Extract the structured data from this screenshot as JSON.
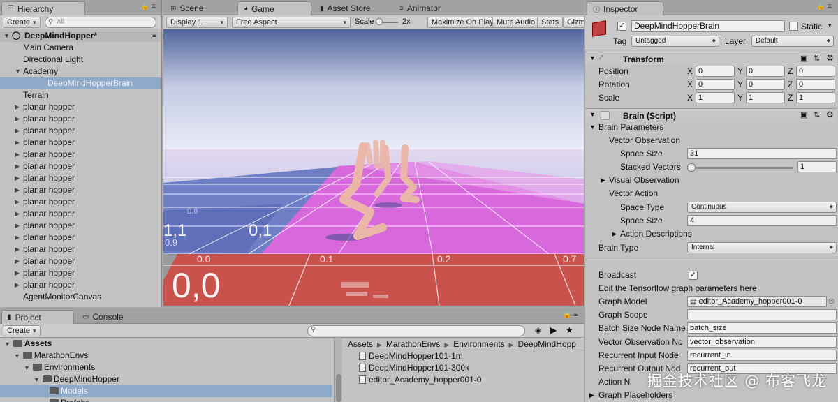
{
  "hierarchy": {
    "tab": "Hierarchy",
    "create": "Create",
    "search_placeholder": "All",
    "scene": "DeepMindHopper*",
    "items": [
      {
        "label": "Main Camera",
        "indent": 1,
        "arrow": false
      },
      {
        "label": "Directional Light",
        "indent": 1,
        "arrow": false
      },
      {
        "label": "Academy",
        "indent": 1,
        "arrow": true,
        "open": true
      },
      {
        "label": "DeepMindHopperBrain",
        "indent": 2,
        "arrow": false,
        "selected": true
      },
      {
        "label": "Terrain",
        "indent": 1,
        "arrow": false
      },
      {
        "label": "planar hopper",
        "indent": 1,
        "arrow": true
      },
      {
        "label": "planar hopper",
        "indent": 1,
        "arrow": true
      },
      {
        "label": "planar hopper",
        "indent": 1,
        "arrow": true
      },
      {
        "label": "planar hopper",
        "indent": 1,
        "arrow": true
      },
      {
        "label": "planar hopper",
        "indent": 1,
        "arrow": true
      },
      {
        "label": "planar hopper",
        "indent": 1,
        "arrow": true
      },
      {
        "label": "planar hopper",
        "indent": 1,
        "arrow": true
      },
      {
        "label": "planar hopper",
        "indent": 1,
        "arrow": true
      },
      {
        "label": "planar hopper",
        "indent": 1,
        "arrow": true
      },
      {
        "label": "planar hopper",
        "indent": 1,
        "arrow": true
      },
      {
        "label": "planar hopper",
        "indent": 1,
        "arrow": true
      },
      {
        "label": "planar hopper",
        "indent": 1,
        "arrow": true
      },
      {
        "label": "planar hopper",
        "indent": 1,
        "arrow": true
      },
      {
        "label": "planar hopper",
        "indent": 1,
        "arrow": true
      },
      {
        "label": "planar hopper",
        "indent": 1,
        "arrow": true
      },
      {
        "label": "planar hopper",
        "indent": 1,
        "arrow": true
      },
      {
        "label": "AgentMonitorCanvas",
        "indent": 1,
        "arrow": false
      }
    ]
  },
  "center_tabs": {
    "scene": "Scene",
    "game": "Game",
    "asset_store": "Asset Store",
    "animator": "Animator"
  },
  "game_toolbar": {
    "display": "Display 1",
    "aspect": "Free Aspect",
    "scale_label": "Scale",
    "scale_value": "2x",
    "maximize": "Maximize On Play",
    "mute": "Mute Audio",
    "stats": "Stats",
    "gizmos": "Gizmo"
  },
  "track_labels": {
    "big_00": "0,0",
    "big_01": "0,1",
    "big_11": "1,1",
    "small_00": "0.0",
    "small_01": "0.1",
    "small_02": "0.2",
    "small_07": "0.7",
    "small_09": "0.9",
    "small_08": "0.8"
  },
  "inspector": {
    "tab": "Inspector",
    "object_name": "DeepMindHopperBrain",
    "static_label": "Static",
    "tag_label": "Tag",
    "tag_value": "Untagged",
    "layer_label": "Layer",
    "layer_value": "Default",
    "transform": {
      "title": "Transform",
      "position_label": "Position",
      "rotation_label": "Rotation",
      "scale_label": "Scale",
      "position": {
        "x": "0",
        "y": "0",
        "z": "0"
      },
      "rotation": {
        "x": "0",
        "y": "0",
        "z": "0"
      },
      "scale": {
        "x": "1",
        "y": "1",
        "z": "1"
      },
      "x_label": "X",
      "y_label": "Y",
      "z_label": "Z"
    },
    "brain": {
      "title": "Brain (Script)",
      "brain_parameters": "Brain Parameters",
      "vector_observation": "Vector Observation",
      "space_size_label": "Space Size",
      "space_size_value": "31",
      "stacked_vectors_label": "Stacked Vectors",
      "stacked_vectors_value": "1",
      "visual_observation": "Visual Observation",
      "vector_action": "Vector Action",
      "space_type_label": "Space Type",
      "space_type_value": "Continuous",
      "action_space_size_label": "Space Size",
      "action_space_size_value": "4",
      "action_descriptions": "Action Descriptions",
      "brain_type_label": "Brain Type",
      "brain_type_value": "Internal",
      "broadcast_label": "Broadcast",
      "tf_note": "Edit the Tensorflow graph parameters here",
      "graph_model_label": "Graph Model",
      "graph_model_value": "editor_Academy_hopper001-0",
      "graph_scope_label": "Graph Scope",
      "graph_scope_value": "",
      "batch_size_label": "Batch Size Node Name",
      "batch_size_value": "batch_size",
      "vector_obs_node_label": "Vector Observation Nc",
      "vector_obs_node_value": "vector_observation",
      "recurrent_input_label": "Recurrent Input Node",
      "recurrent_input_value": "recurrent_in",
      "recurrent_output_label": "Recurrent Output Nod",
      "recurrent_output_value": "recurrent_out",
      "action_node_label": "Action N",
      "graph_placeholders": "Graph Placeholders"
    }
  },
  "project": {
    "tab": "Project",
    "console_tab": "Console",
    "create": "Create",
    "tree": [
      {
        "label": "Assets",
        "indent": 0,
        "bold": true
      },
      {
        "label": "MarathonEnvs",
        "indent": 1
      },
      {
        "label": "Environments",
        "indent": 2
      },
      {
        "label": "DeepMindHopper",
        "indent": 3
      },
      {
        "label": "Models",
        "indent": 4,
        "selected": true
      },
      {
        "label": "Prefabs",
        "indent": 4
      }
    ],
    "breadcrumb": [
      "Assets",
      "MarathonEnvs",
      "Environments",
      "DeepMindHopp"
    ],
    "files": [
      "DeepMindHopper101-1m",
      "DeepMindHopper101-300k",
      "editor_Academy_hopper001-0"
    ]
  },
  "watermark": "掘金技术社区 @ 布客飞龙"
}
